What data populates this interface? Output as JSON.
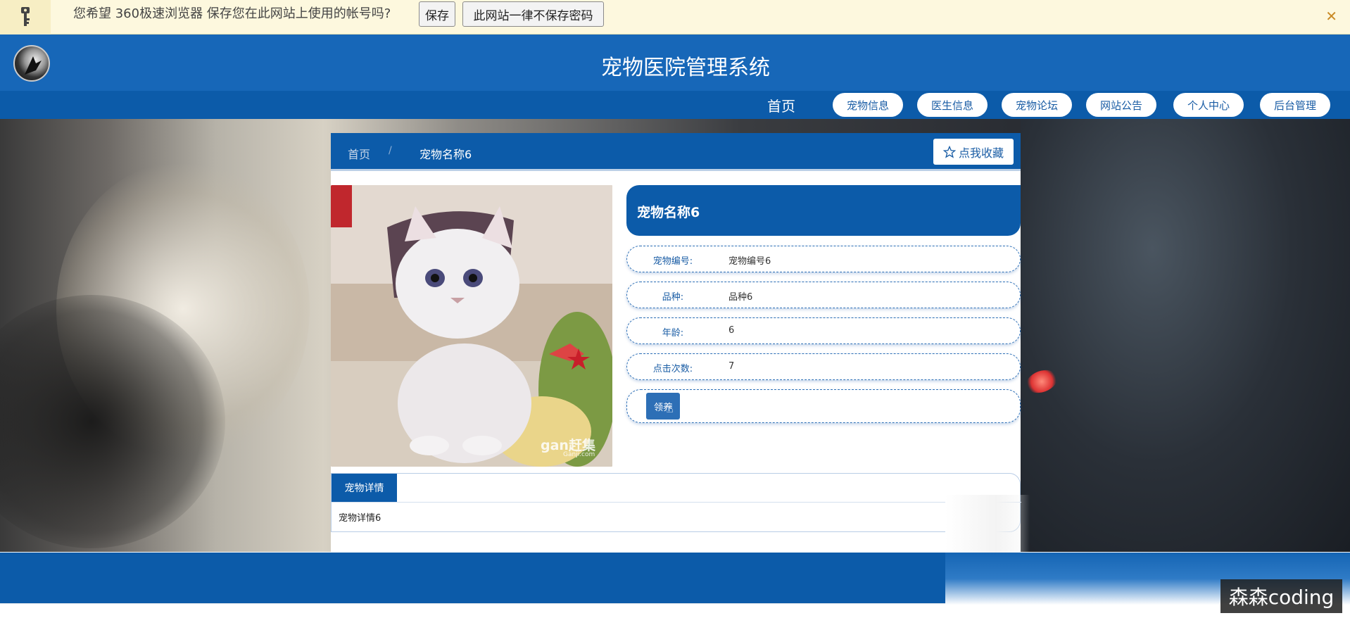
{
  "password_bar": {
    "message": "您希望 360极速浏览器 保存您在此网站上使用的帐号吗?",
    "save_label": "保存",
    "never_label": "此网站一律不保存密码",
    "close_glyph": "✕"
  },
  "header": {
    "title": "宠物医院管理系统"
  },
  "nav": {
    "home": "首页",
    "items": [
      "宠物信息",
      "医生信息",
      "宠物论坛",
      "网站公告",
      "个人中心",
      "后台管理"
    ]
  },
  "breadcrumb": {
    "home": "首页",
    "separator": "/",
    "current": "宠物名称6"
  },
  "favorite_button": "点我收藏",
  "pet": {
    "name": "宠物名称6",
    "fields": [
      {
        "label": "宠物编号:",
        "value": "宠物编号6"
      },
      {
        "label": "品种:",
        "value": "品种6"
      },
      {
        "label": "年龄:",
        "value": "6"
      },
      {
        "label": "点击次数:",
        "value": "7"
      }
    ],
    "action_button": "领养"
  },
  "photo_watermark": "gan赶集",
  "photo_watermark_url": "Ganji.com",
  "tabs": {
    "active": "宠物详情",
    "content": "宠物详情6"
  },
  "watermark": "森森coding",
  "colors": {
    "primary": "#0c5ba9",
    "header": "#1767b8",
    "bar_bg": "#fdf8de"
  }
}
